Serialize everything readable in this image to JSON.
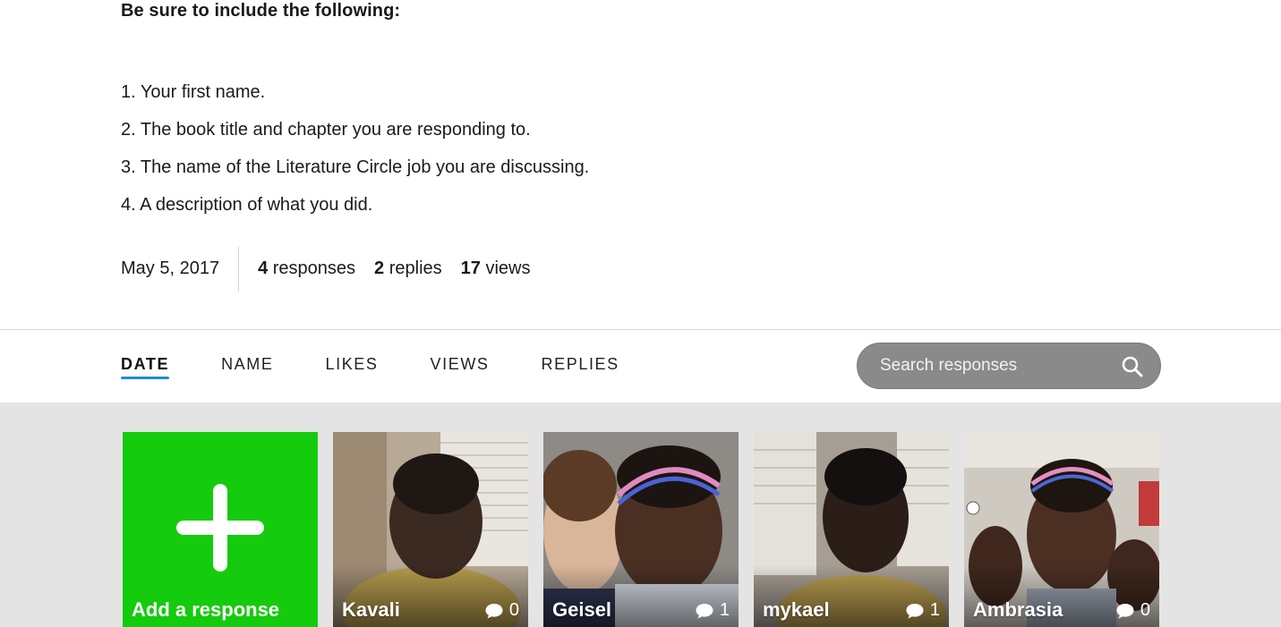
{
  "prompt": {
    "heading": "Be sure to include the following:",
    "items": [
      "1. Your first name.",
      "2. The book title and chapter you are responding to.",
      "3. The name of the Literature Circle job you are discussing.",
      "4. A description of what you did."
    ]
  },
  "stats": {
    "date": "May 5, 2017",
    "responses_count": "4",
    "responses_label": " responses",
    "replies_count": "2",
    "replies_label": " replies",
    "views_count": "17",
    "views_label": " views"
  },
  "sort_tabs": [
    {
      "label": "DATE",
      "active": true
    },
    {
      "label": "NAME",
      "active": false
    },
    {
      "label": "LIKES",
      "active": false
    },
    {
      "label": "VIEWS",
      "active": false
    },
    {
      "label": "REPLIES",
      "active": false
    }
  ],
  "search": {
    "placeholder": "Search responses",
    "icon": "search-icon"
  },
  "add_tile": {
    "label": "Add a response",
    "icon": "plus-icon",
    "color": "#15cb0d"
  },
  "responses": [
    {
      "name": "Kavali",
      "reply_count": "0",
      "icon": "comment-bubble-icon"
    },
    {
      "name": "Geisel",
      "reply_count": "1",
      "icon": "comment-bubble-icon"
    },
    {
      "name": "mykael",
      "reply_count": "1",
      "icon": "comment-bubble-icon"
    },
    {
      "name": "Ambrasia",
      "reply_count": "0",
      "icon": "comment-bubble-icon"
    }
  ],
  "colors": {
    "accent_underline": "#1a8fd1",
    "search_background": "#8a8a8a",
    "grid_background": "#e4e4e4"
  }
}
